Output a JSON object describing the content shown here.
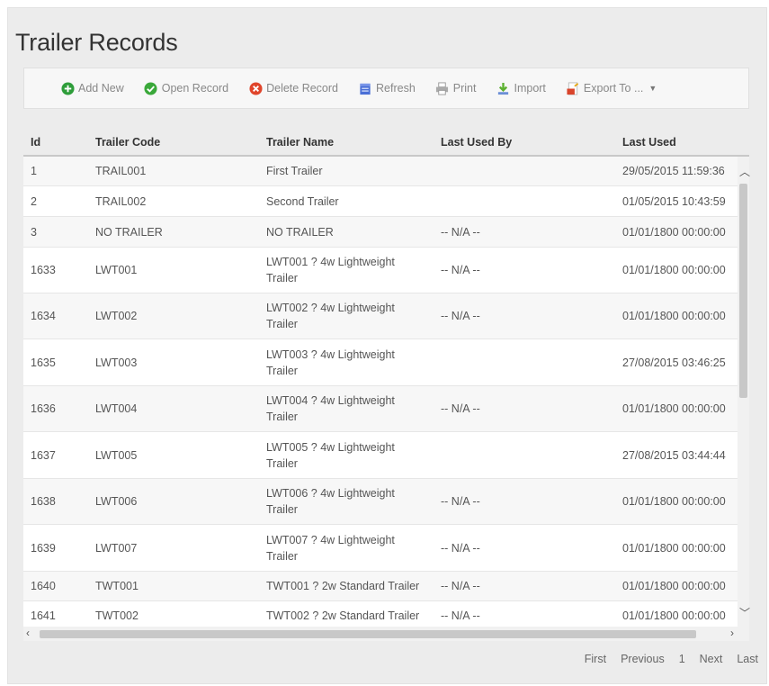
{
  "page": {
    "title": "Trailer Records"
  },
  "toolbar": {
    "buttons": [
      {
        "label": "Add New",
        "icon": "add-icon",
        "color": "#2e9d3a"
      },
      {
        "label": "Open Record",
        "icon": "check-icon",
        "color": "#3aa83a"
      },
      {
        "label": "Delete Record",
        "icon": "delete-icon",
        "color": "#e0452b"
      },
      {
        "label": "Refresh",
        "icon": "refresh-icon",
        "color": "#4a6fd6"
      },
      {
        "label": "Print",
        "icon": "print-icon",
        "color": "#9a9a9a"
      },
      {
        "label": "Import",
        "icon": "import-icon",
        "color": "#5cb030"
      },
      {
        "label": "Export To ...",
        "icon": "export-icon",
        "color": "#d9442b"
      }
    ]
  },
  "table": {
    "columns": [
      "Id",
      "Trailer Code",
      "Trailer Name",
      "Last Used By",
      "Last Used"
    ],
    "rows": [
      {
        "id": "1",
        "code": "TRAIL001",
        "name": "First Trailer",
        "user": "",
        "last": "29/05/2015 11:59:36"
      },
      {
        "id": "2",
        "code": "TRAIL002",
        "name": "Second Trailer",
        "user": "",
        "last": "01/05/2015 10:43:59"
      },
      {
        "id": "3",
        "code": "NO TRAILER",
        "name": "NO TRAILER",
        "user": "-- N/A --",
        "last": "01/01/1800 00:00:00"
      },
      {
        "id": "1633",
        "code": "LWT001",
        "name": "LWT001 ? 4w Lightweight Trailer",
        "user": "-- N/A --",
        "last": "01/01/1800 00:00:00"
      },
      {
        "id": "1634",
        "code": "LWT002",
        "name": "LWT002 ? 4w Lightweight Trailer",
        "user": "-- N/A --",
        "last": "01/01/1800 00:00:00"
      },
      {
        "id": "1635",
        "code": "LWT003",
        "name": "LWT003 ? 4w Lightweight Trailer",
        "user": "",
        "last": "27/08/2015 03:46:25"
      },
      {
        "id": "1636",
        "code": "LWT004",
        "name": "LWT004 ? 4w Lightweight Trailer",
        "user": "-- N/A --",
        "last": "01/01/1800 00:00:00"
      },
      {
        "id": "1637",
        "code": "LWT005",
        "name": "LWT005 ? 4w Lightweight Trailer",
        "user": "",
        "last": "27/08/2015 03:44:44"
      },
      {
        "id": "1638",
        "code": "LWT006",
        "name": "LWT006 ? 4w Lightweight Trailer",
        "user": "-- N/A --",
        "last": "01/01/1800 00:00:00"
      },
      {
        "id": "1639",
        "code": "LWT007",
        "name": "LWT007 ? 4w Lightweight Trailer",
        "user": "-- N/A --",
        "last": "01/01/1800 00:00:00"
      },
      {
        "id": "1640",
        "code": "TWT001",
        "name": "TWT001 ? 2w Standard Trailer",
        "user": "-- N/A --",
        "last": "01/01/1800 00:00:00"
      },
      {
        "id": "1641",
        "code": "TWT002",
        "name": "TWT002 ? 2w Standard Trailer",
        "user": "-- N/A --",
        "last": "01/01/1800 00:00:00"
      }
    ]
  },
  "pager": {
    "first": "First",
    "previous": "Previous",
    "page": "1",
    "next": "Next",
    "last": "Last"
  }
}
